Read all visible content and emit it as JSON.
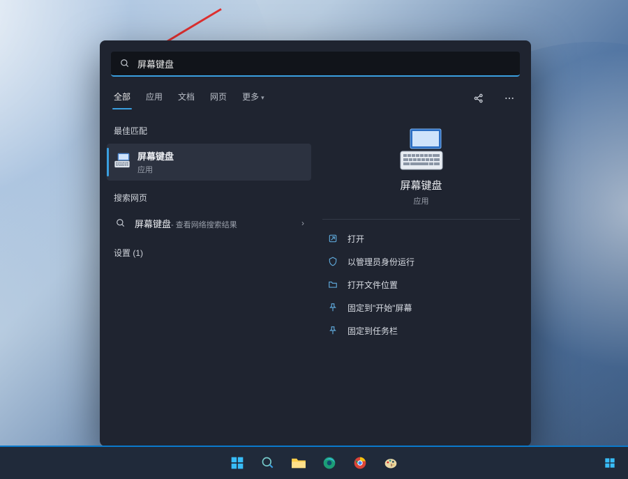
{
  "search": {
    "value": "屏幕键盘"
  },
  "tabs": [
    {
      "label": "全部",
      "active": true
    },
    {
      "label": "应用",
      "active": false
    },
    {
      "label": "文档",
      "active": false
    },
    {
      "label": "网页",
      "active": false
    },
    {
      "label": "更多",
      "active": false,
      "dropdown": true
    }
  ],
  "sections": {
    "best": "最佳匹配",
    "web": "搜索网页",
    "settings": "设置 (1)"
  },
  "best_result": {
    "title": "屏幕键盘",
    "subtitle": "应用"
  },
  "web_result": {
    "title": "屏幕键盘",
    "tail": " - 查看网络搜索结果"
  },
  "detail": {
    "title": "屏幕键盘",
    "subtitle": "应用"
  },
  "actions": [
    {
      "icon": "open-icon",
      "label": "打开"
    },
    {
      "icon": "admin-icon",
      "label": "以管理员身份运行"
    },
    {
      "icon": "folder-icon",
      "label": "打开文件位置"
    },
    {
      "icon": "pin-icon",
      "label": "固定到\"开始\"屏幕"
    },
    {
      "icon": "pin-icon",
      "label": "固定到任务栏"
    }
  ],
  "taskbar": {
    "items": [
      "start-icon",
      "search-icon",
      "explorer-icon",
      "edge-icon",
      "chrome-icon",
      "paint-icon"
    ]
  }
}
